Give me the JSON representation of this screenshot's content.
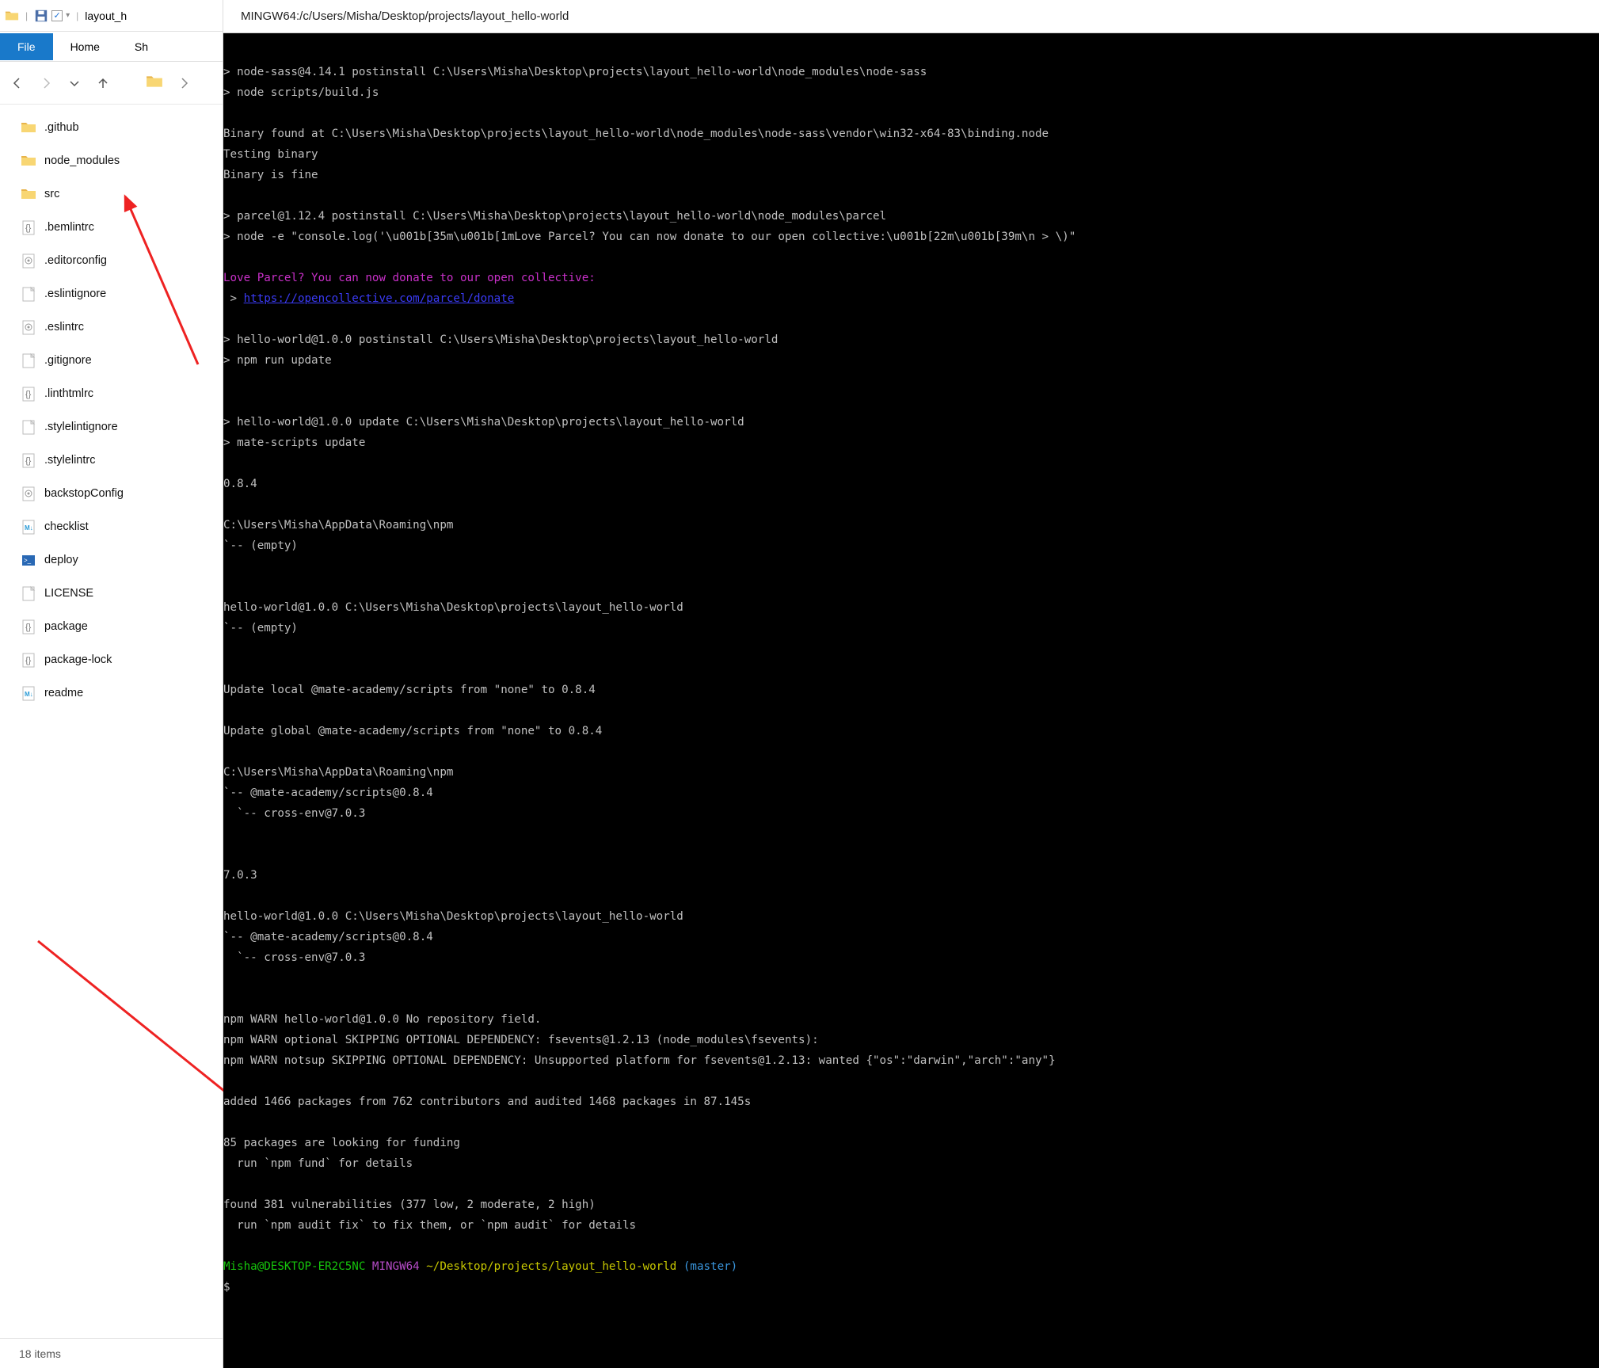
{
  "explorer": {
    "title": "layout_h",
    "ribbon": {
      "file": "File",
      "home": "Home",
      "share": "Sh"
    },
    "files": [
      {
        "name": ".github",
        "type": "folder"
      },
      {
        "name": "node_modules",
        "type": "folder"
      },
      {
        "name": "src",
        "type": "folder"
      },
      {
        "name": ".bemlintrc",
        "type": "config-json"
      },
      {
        "name": ".editorconfig",
        "type": "config"
      },
      {
        "name": ".eslintignore",
        "type": "file"
      },
      {
        "name": ".eslintrc",
        "type": "config-js"
      },
      {
        "name": ".gitignore",
        "type": "file"
      },
      {
        "name": ".linthtmlrc",
        "type": "config-json"
      },
      {
        "name": ".stylelintignore",
        "type": "file"
      },
      {
        "name": ".stylelintrc",
        "type": "config-json"
      },
      {
        "name": "backstopConfig",
        "type": "config-js"
      },
      {
        "name": "checklist",
        "type": "md"
      },
      {
        "name": "deploy",
        "type": "ps"
      },
      {
        "name": "LICENSE",
        "type": "file"
      },
      {
        "name": "package",
        "type": "json"
      },
      {
        "name": "package-lock",
        "type": "json"
      },
      {
        "name": "readme",
        "type": "md"
      }
    ],
    "status": "18 items"
  },
  "terminal": {
    "title": "MINGW64:/c/Users/Misha/Desktop/projects/layout_hello-world",
    "lines": [
      {
        "t": "",
        "c": "white"
      },
      {
        "t": "> node-sass@4.14.1 postinstall C:\\Users\\Misha\\Desktop\\projects\\layout_hello-world\\node_modules\\node-sass",
        "c": "white"
      },
      {
        "t": "> node scripts/build.js",
        "c": "white"
      },
      {
        "t": "",
        "c": "white"
      },
      {
        "t": "Binary found at C:\\Users\\Misha\\Desktop\\projects\\layout_hello-world\\node_modules\\node-sass\\vendor\\win32-x64-83\\binding.node",
        "c": "white"
      },
      {
        "t": "Testing binary",
        "c": "white"
      },
      {
        "t": "Binary is fine",
        "c": "white"
      },
      {
        "t": "",
        "c": "white"
      },
      {
        "t": "> parcel@1.12.4 postinstall C:\\Users\\Misha\\Desktop\\projects\\layout_hello-world\\node_modules\\parcel",
        "c": "white"
      },
      {
        "t": "> node -e \"console.log('\\u001b[35m\\u001b[1mLove Parcel? You can now donate to our open collective:\\u001b[22m\\u001b[39m\\n > \\)\"",
        "c": "white"
      },
      {
        "t": "",
        "c": "white"
      },
      {
        "t": "Love Parcel? You can now donate to our open collective:",
        "c": "mag"
      },
      {
        "segments": [
          {
            "t": " > ",
            "c": "white"
          },
          {
            "t": "https://opencollective.com/parcel/donate",
            "c": "blue"
          }
        ]
      },
      {
        "t": "",
        "c": "white"
      },
      {
        "t": "> hello-world@1.0.0 postinstall C:\\Users\\Misha\\Desktop\\projects\\layout_hello-world",
        "c": "white"
      },
      {
        "t": "> npm run update",
        "c": "white"
      },
      {
        "t": "",
        "c": "white"
      },
      {
        "t": "",
        "c": "white"
      },
      {
        "t": "> hello-world@1.0.0 update C:\\Users\\Misha\\Desktop\\projects\\layout_hello-world",
        "c": "white"
      },
      {
        "t": "> mate-scripts update",
        "c": "white"
      },
      {
        "t": "",
        "c": "white"
      },
      {
        "t": "0.8.4",
        "c": "white"
      },
      {
        "t": "",
        "c": "white"
      },
      {
        "t": "C:\\Users\\Misha\\AppData\\Roaming\\npm",
        "c": "white"
      },
      {
        "t": "`-- (empty)",
        "c": "white"
      },
      {
        "t": "",
        "c": "white"
      },
      {
        "t": "",
        "c": "white"
      },
      {
        "t": "hello-world@1.0.0 C:\\Users\\Misha\\Desktop\\projects\\layout_hello-world",
        "c": "white"
      },
      {
        "t": "`-- (empty)",
        "c": "white"
      },
      {
        "t": "",
        "c": "white"
      },
      {
        "t": "",
        "c": "white"
      },
      {
        "t": "Update local @mate-academy/scripts from \"none\" to 0.8.4",
        "c": "white"
      },
      {
        "t": "",
        "c": "white"
      },
      {
        "t": "Update global @mate-academy/scripts from \"none\" to 0.8.4",
        "c": "white"
      },
      {
        "t": "",
        "c": "white"
      },
      {
        "t": "C:\\Users\\Misha\\AppData\\Roaming\\npm",
        "c": "white"
      },
      {
        "t": "`-- @mate-academy/scripts@0.8.4",
        "c": "white"
      },
      {
        "t": "  `-- cross-env@7.0.3",
        "c": "white"
      },
      {
        "t": "",
        "c": "white"
      },
      {
        "t": "",
        "c": "white"
      },
      {
        "t": "7.0.3",
        "c": "white"
      },
      {
        "t": "",
        "c": "white"
      },
      {
        "t": "hello-world@1.0.0 C:\\Users\\Misha\\Desktop\\projects\\layout_hello-world",
        "c": "white"
      },
      {
        "t": "`-- @mate-academy/scripts@0.8.4",
        "c": "white"
      },
      {
        "t": "  `-- cross-env@7.0.3",
        "c": "white"
      },
      {
        "t": "",
        "c": "white"
      },
      {
        "t": "",
        "c": "white"
      },
      {
        "t": "npm WARN hello-world@1.0.0 No repository field.",
        "c": "white"
      },
      {
        "t": "npm WARN optional SKIPPING OPTIONAL DEPENDENCY: fsevents@1.2.13 (node_modules\\fsevents):",
        "c": "white"
      },
      {
        "t": "npm WARN notsup SKIPPING OPTIONAL DEPENDENCY: Unsupported platform for fsevents@1.2.13: wanted {\"os\":\"darwin\",\"arch\":\"any\"}",
        "c": "white"
      },
      {
        "t": "",
        "c": "white"
      },
      {
        "t": "added 1466 packages from 762 contributors and audited 1468 packages in 87.145s",
        "c": "white"
      },
      {
        "t": "",
        "c": "white"
      },
      {
        "t": "85 packages are looking for funding",
        "c": "white"
      },
      {
        "t": "  run `npm fund` for details",
        "c": "white"
      },
      {
        "t": "",
        "c": "white"
      },
      {
        "t": "found 381 vulnerabilities (377 low, 2 moderate, 2 high)",
        "c": "white"
      },
      {
        "t": "  run `npm audit fix` to fix them, or `npm audit` for details",
        "c": "white"
      },
      {
        "t": "",
        "c": "white"
      },
      {
        "segments": [
          {
            "t": "Misha@DESKTOP-ER2C5NC ",
            "c": "green"
          },
          {
            "t": "MINGW64 ",
            "c": "purp"
          },
          {
            "t": "~/Desktop/projects/layout_hello-world ",
            "c": "yellow"
          },
          {
            "t": "(master)",
            "c": "cyan"
          }
        ]
      },
      {
        "t": "$ ",
        "c": "white"
      }
    ]
  }
}
